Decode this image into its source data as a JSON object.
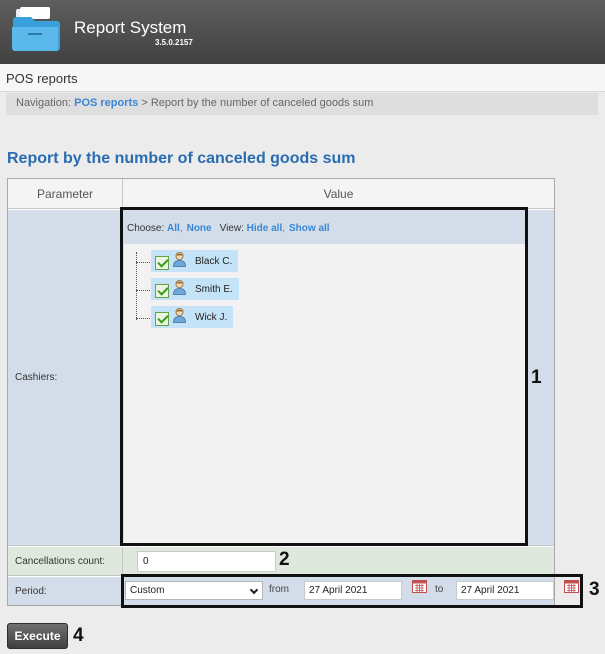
{
  "header": {
    "app_name": "Report System",
    "version": "3.5.0.2157",
    "logo_icon": "folder-icon"
  },
  "section": {
    "title": "POS reports"
  },
  "navigation": {
    "prefix": "Navigation:",
    "link": "POS reports",
    "separator": ">",
    "current": "Report by the number of canceled goods sum"
  },
  "report": {
    "title": "Report by the number of canceled goods sum",
    "columns": {
      "parameter": "Parameter",
      "value": "Value"
    },
    "cashiers": {
      "label": "Cashiers:",
      "choose_label": "Choose:",
      "choose_all": "All",
      "choose_none": "None",
      "view_label": "View:",
      "hide_all": "Hide all",
      "show_all": "Show all",
      "items": [
        {
          "name": "Black C.",
          "checked": true,
          "icon": "person-icon"
        },
        {
          "name": "Smith E.",
          "checked": true,
          "icon": "person-icon"
        },
        {
          "name": "Wick J.",
          "checked": true,
          "icon": "person-icon"
        }
      ]
    },
    "cancellations": {
      "label": "Cancellations count:",
      "value": "0"
    },
    "period": {
      "label": "Period:",
      "selected": "Custom",
      "from_label": "from",
      "from_value": "27 April 2021",
      "to_label": "to",
      "to_value": "27 April 2021",
      "calendar_icon": "calendar-icon"
    },
    "execute_label": "Execute"
  },
  "callouts": [
    "1",
    "2",
    "3",
    "4"
  ],
  "colors": {
    "header_bg": "#4a4a4a",
    "title_blue": "#2a6cb0",
    "link_blue": "#3b86d4",
    "row_blue": "#d3dde9",
    "row_green": "#dfe8dd",
    "selected_item": "#c5e3f6"
  }
}
